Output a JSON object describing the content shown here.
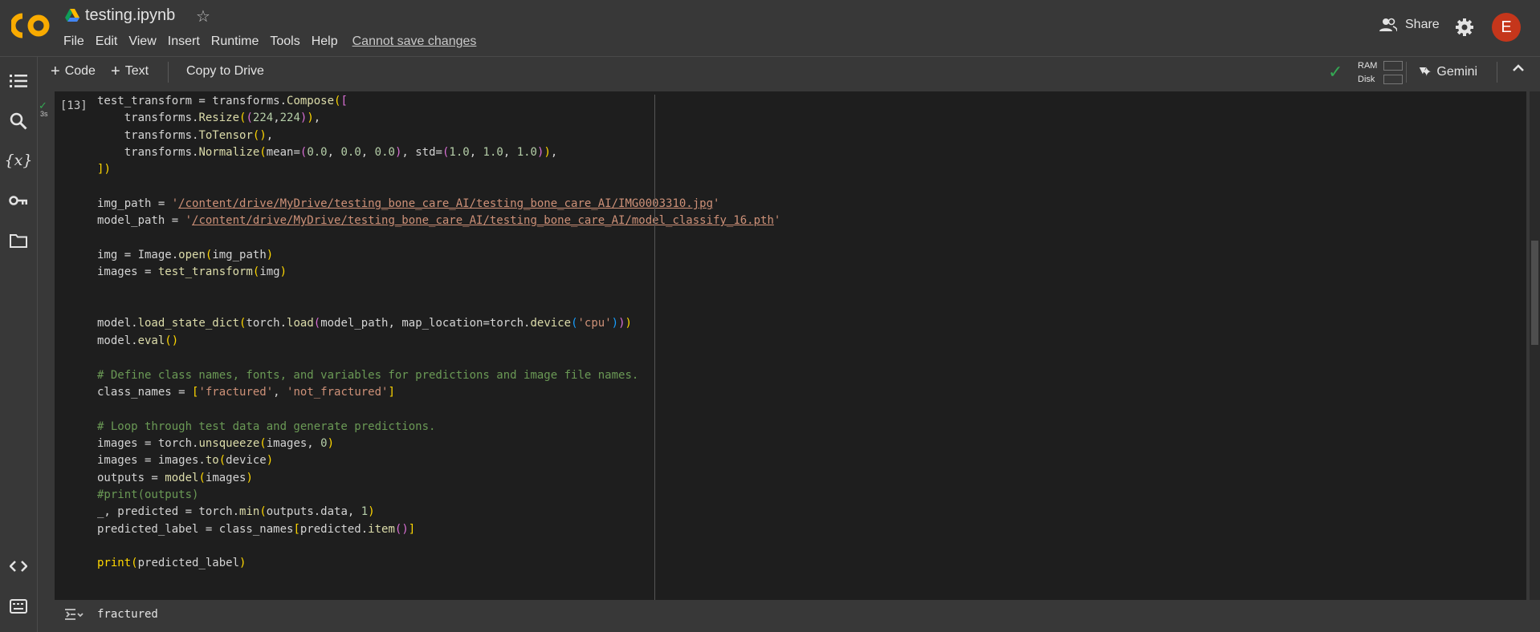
{
  "header": {
    "file_title": "testing.ipynb",
    "menu": [
      "File",
      "Edit",
      "View",
      "Insert",
      "Runtime",
      "Tools",
      "Help"
    ],
    "save_status": "Cannot save changes",
    "share_label": "Share",
    "avatar_letter": "E"
  },
  "toolbar": {
    "code_label": "Code",
    "text_label": "Text",
    "copy_label": "Copy to Drive",
    "ram_label": "RAM",
    "disk_label": "Disk",
    "gemini_label": "Gemini"
  },
  "cell": {
    "exec_count": "[13]",
    "exec_time": "3s",
    "code_lines": [
      "test_transform = transforms.Compose([",
      "    transforms.Resize((224,224)),",
      "    transforms.ToTensor(),",
      "    transforms.Normalize(mean=(0.0, 0.0, 0.0), std=(1.0, 1.0, 1.0)),",
      "])",
      "",
      "img_path = '/content/drive/MyDrive/testing_bone_care_AI/testing_bone_care_AI/IMG0003310.jpg'",
      "model_path = '/content/drive/MyDrive/testing_bone_care_AI/testing_bone_care_AI/model_classify_16.pth'",
      "",
      "img = Image.open(img_path)",
      "images = test_transform(img)",
      "",
      "",
      "model.load_state_dict(torch.load(model_path, map_location=torch.device('cpu')))",
      "model.eval()",
      "",
      "# Define class names, fonts, and variables for predictions and image file names.",
      "class_names = ['fractured', 'not_fractured']",
      "",
      "# Loop through test data and generate predictions.",
      "images = torch.unsqueeze(images, 0)",
      "images = images.to(device)",
      "outputs = model(images)",
      "#print(outputs)",
      "_, predicted = torch.min(outputs.data, 1)",
      "predicted_label = class_names[predicted.item()]",
      "",
      "print(predicted_label)"
    ]
  },
  "output": {
    "text": "fractured"
  },
  "colors": {
    "accent_green": "#34a853",
    "avatar_bg": "#c5361b",
    "logo_orange": "#f9ab00"
  },
  "icons": {
    "rail": [
      "toc-icon",
      "search-icon",
      "variables-icon",
      "key-icon",
      "folder-icon",
      "code-snippets-icon",
      "terminal-icon"
    ]
  }
}
